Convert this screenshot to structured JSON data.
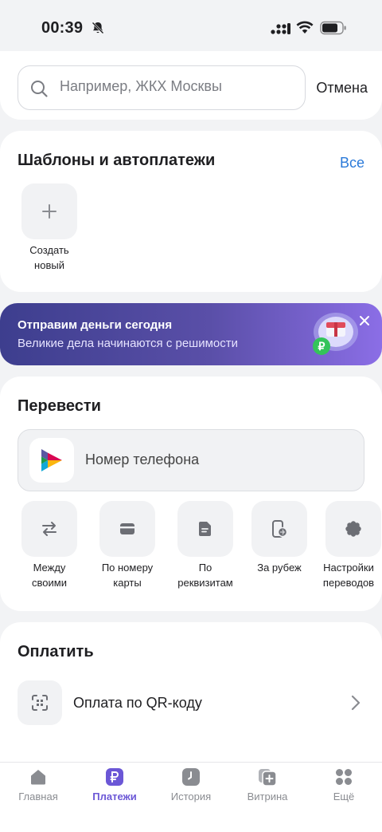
{
  "status_bar": {
    "time": "00:39"
  },
  "search": {
    "placeholder": "Например, ЖКХ Москвы",
    "cancel_label": "Отмена"
  },
  "templates": {
    "title": "Шаблоны и автоплатежи",
    "all_label": "Все",
    "create_label_line1": "Создать",
    "create_label_line2": "новый"
  },
  "promo": {
    "title": "Отправим деньги сегодня",
    "subtitle": "Великие дела начинаются с решимости"
  },
  "transfer": {
    "title": "Перевести",
    "phone_label": "Номер телефона",
    "actions": [
      {
        "line1": "Между",
        "line2": "своими",
        "icon": "arrows-swap-icon"
      },
      {
        "line1": "По номеру",
        "line2": "карты",
        "icon": "card-icon"
      },
      {
        "line1": "По",
        "line2": "реквизитам",
        "icon": "document-icon"
      },
      {
        "line1": "За рубеж",
        "line2": "",
        "icon": "globe-phone-icon"
      },
      {
        "line1": "Настройки",
        "line2": "переводов",
        "icon": "gear-icon"
      }
    ]
  },
  "pay": {
    "title": "Оплатить",
    "items": [
      {
        "label": "Оплата по QR-коду",
        "icon": "qr-scan-icon"
      }
    ]
  },
  "tabbar": {
    "items": [
      {
        "label": "Главная",
        "icon": "home-icon",
        "active": false
      },
      {
        "label": "Платежи",
        "icon": "ruble-icon",
        "active": true
      },
      {
        "label": "История",
        "icon": "clock-icon",
        "active": false
      },
      {
        "label": "Витрина",
        "icon": "showcase-icon",
        "active": false
      },
      {
        "label": "Ещё",
        "icon": "grid-icon",
        "active": false
      }
    ]
  },
  "colors": {
    "accent": "#6b57d6",
    "link": "#2b7ad9",
    "promo_start": "#3d3e8e",
    "promo_end": "#8b6ee6"
  }
}
